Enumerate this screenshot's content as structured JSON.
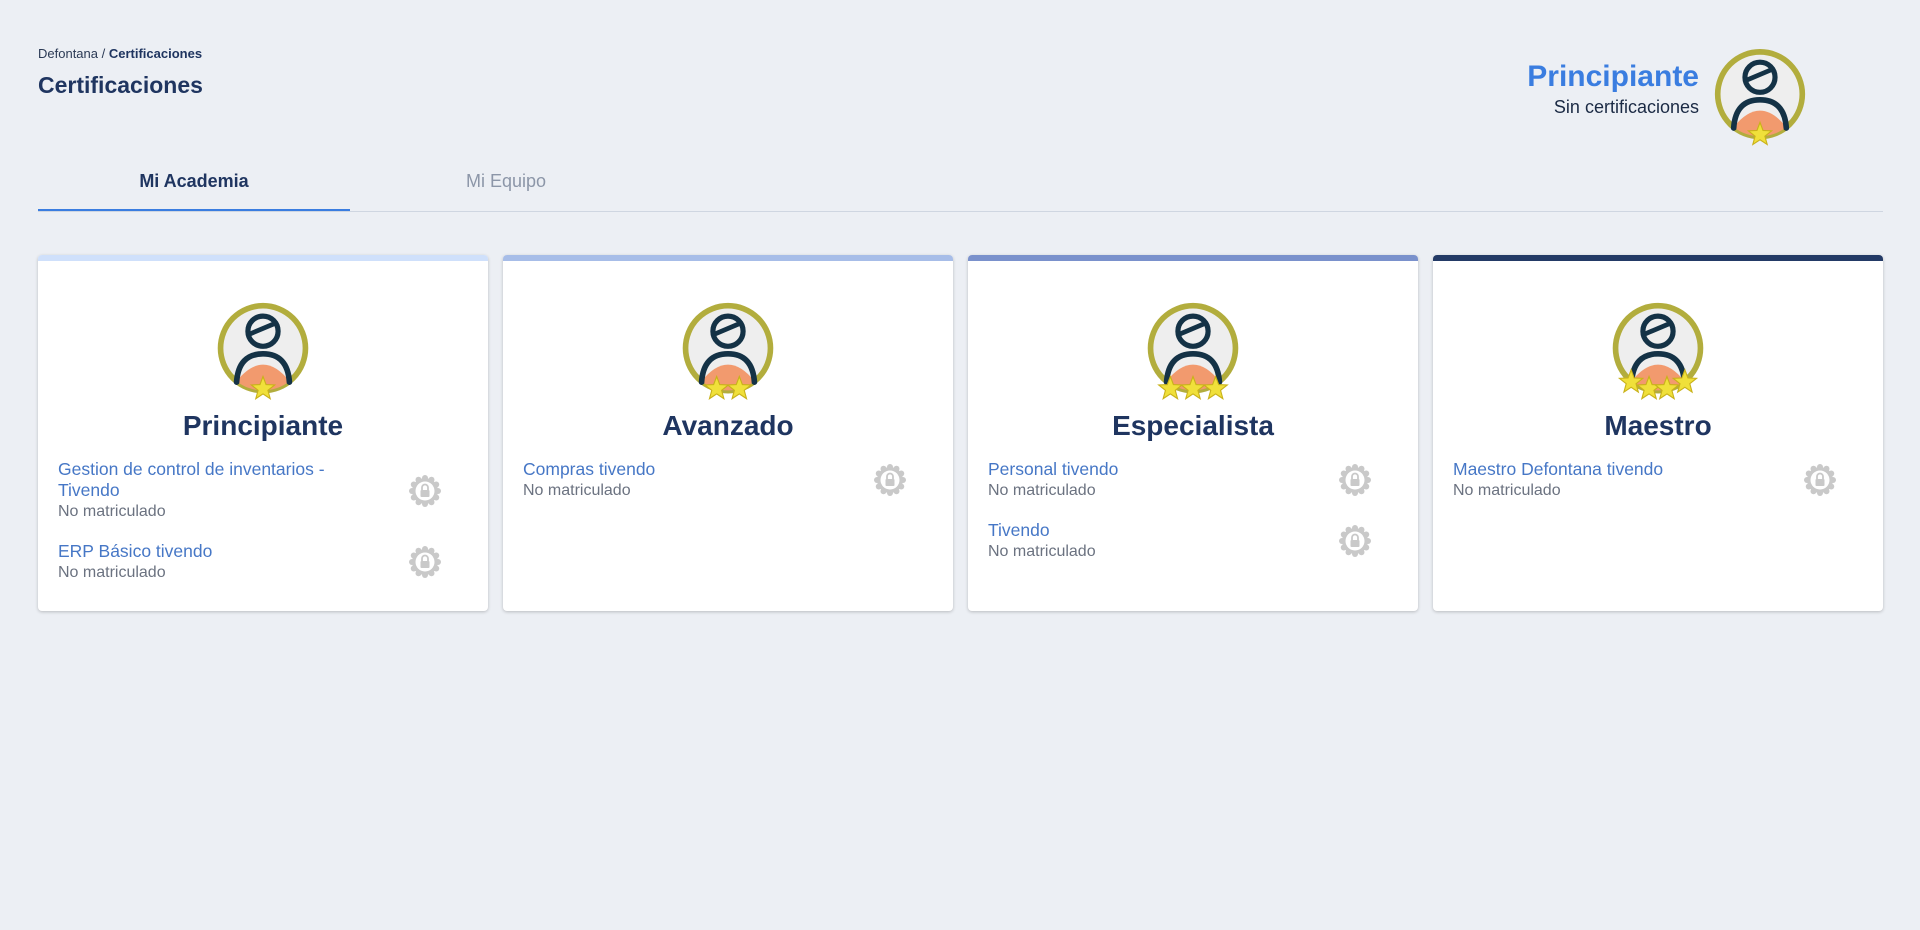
{
  "breadcrumb": {
    "root": "Defontana",
    "separator": " / ",
    "current": "Certificaciones"
  },
  "page_title": "Certificaciones",
  "user_level": {
    "name": "Principiante",
    "subtitle": "Sin certificaciones",
    "stars": 1
  },
  "tabs": [
    {
      "label": "Mi Academia",
      "active": true
    },
    {
      "label": "Mi Equipo",
      "active": false
    }
  ],
  "cards": [
    {
      "title": "Principiante",
      "stars": 1,
      "bar_color": "#cfe0fb",
      "courses": [
        {
          "name": "Gestion de control de inventarios - Tivendo",
          "status": "No matriculado"
        },
        {
          "name": "ERP Básico tivendo",
          "status": "No matriculado"
        }
      ]
    },
    {
      "title": "Avanzado",
      "stars": 2,
      "bar_color": "#a7bde8",
      "courses": [
        {
          "name": "Compras tivendo",
          "status": "No matriculado"
        }
      ]
    },
    {
      "title": "Especialista",
      "stars": 3,
      "bar_color": "#7a91cc",
      "courses": [
        {
          "name": "Personal tivendo",
          "status": "No matriculado"
        },
        {
          "name": "Tivendo",
          "status": "No matriculado"
        }
      ]
    },
    {
      "title": "Maestro",
      "stars": 4,
      "bar_color": "#233a66",
      "courses": [
        {
          "name": "Maestro Defontana tivendo",
          "status": "No matriculado"
        }
      ]
    }
  ],
  "colors": {
    "accent": "#3a7de0",
    "badge_ring": "#b2ad3d",
    "star": "#f0e03a",
    "lock": "#c9c9c9"
  }
}
